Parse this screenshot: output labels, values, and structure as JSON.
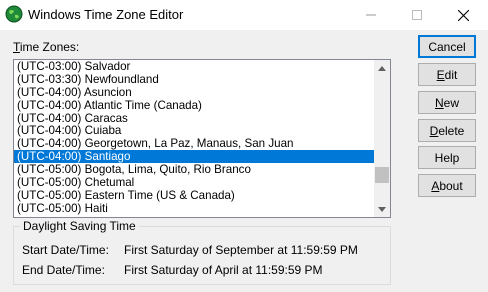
{
  "window": {
    "title": "Windows Time Zone Editor"
  },
  "time_zones": {
    "label_prefix": "T",
    "label_rest": "ime Zones:",
    "items": [
      "(UTC-03:00) Salvador",
      "(UTC-03:30) Newfoundland",
      "(UTC-04:00) Asuncion",
      "(UTC-04:00) Atlantic Time (Canada)",
      "(UTC-04:00) Caracas",
      "(UTC-04:00) Cuiaba",
      "(UTC-04:00) Georgetown, La Paz, Manaus, San Juan",
      "(UTC-04:00) Santiago",
      "(UTC-05:00) Bogota, Lima, Quito, Rio Branco",
      "(UTC-05:00) Chetumal",
      "(UTC-05:00) Eastern Time (US & Canada)",
      "(UTC-05:00) Haiti"
    ],
    "selected": "(UTC-04:00) Santiago"
  },
  "buttons": {
    "cancel": "Cancel",
    "edit_prefix": "E",
    "edit_rest": "dit",
    "new_prefix": "N",
    "new_rest": "ew",
    "delete_prefix": "D",
    "delete_rest": "elete",
    "help": "Help",
    "about_prefix": "A",
    "about_rest": "bout"
  },
  "dst": {
    "group_title": "Daylight Saving Time",
    "start_label": "Start Date/Time:",
    "start_value": "First Saturday of September at 11:59:59 PM",
    "end_label": "End Date/Time:",
    "end_value": "First Saturday of April at 11:59:59 PM"
  },
  "colors": {
    "selection": "#0078d7",
    "default_button_border": "#0078d7"
  },
  "icons": [
    "globe-icon",
    "minimize-icon",
    "maximize-icon",
    "close-icon",
    "scroll-up-icon",
    "scroll-down-icon"
  ]
}
